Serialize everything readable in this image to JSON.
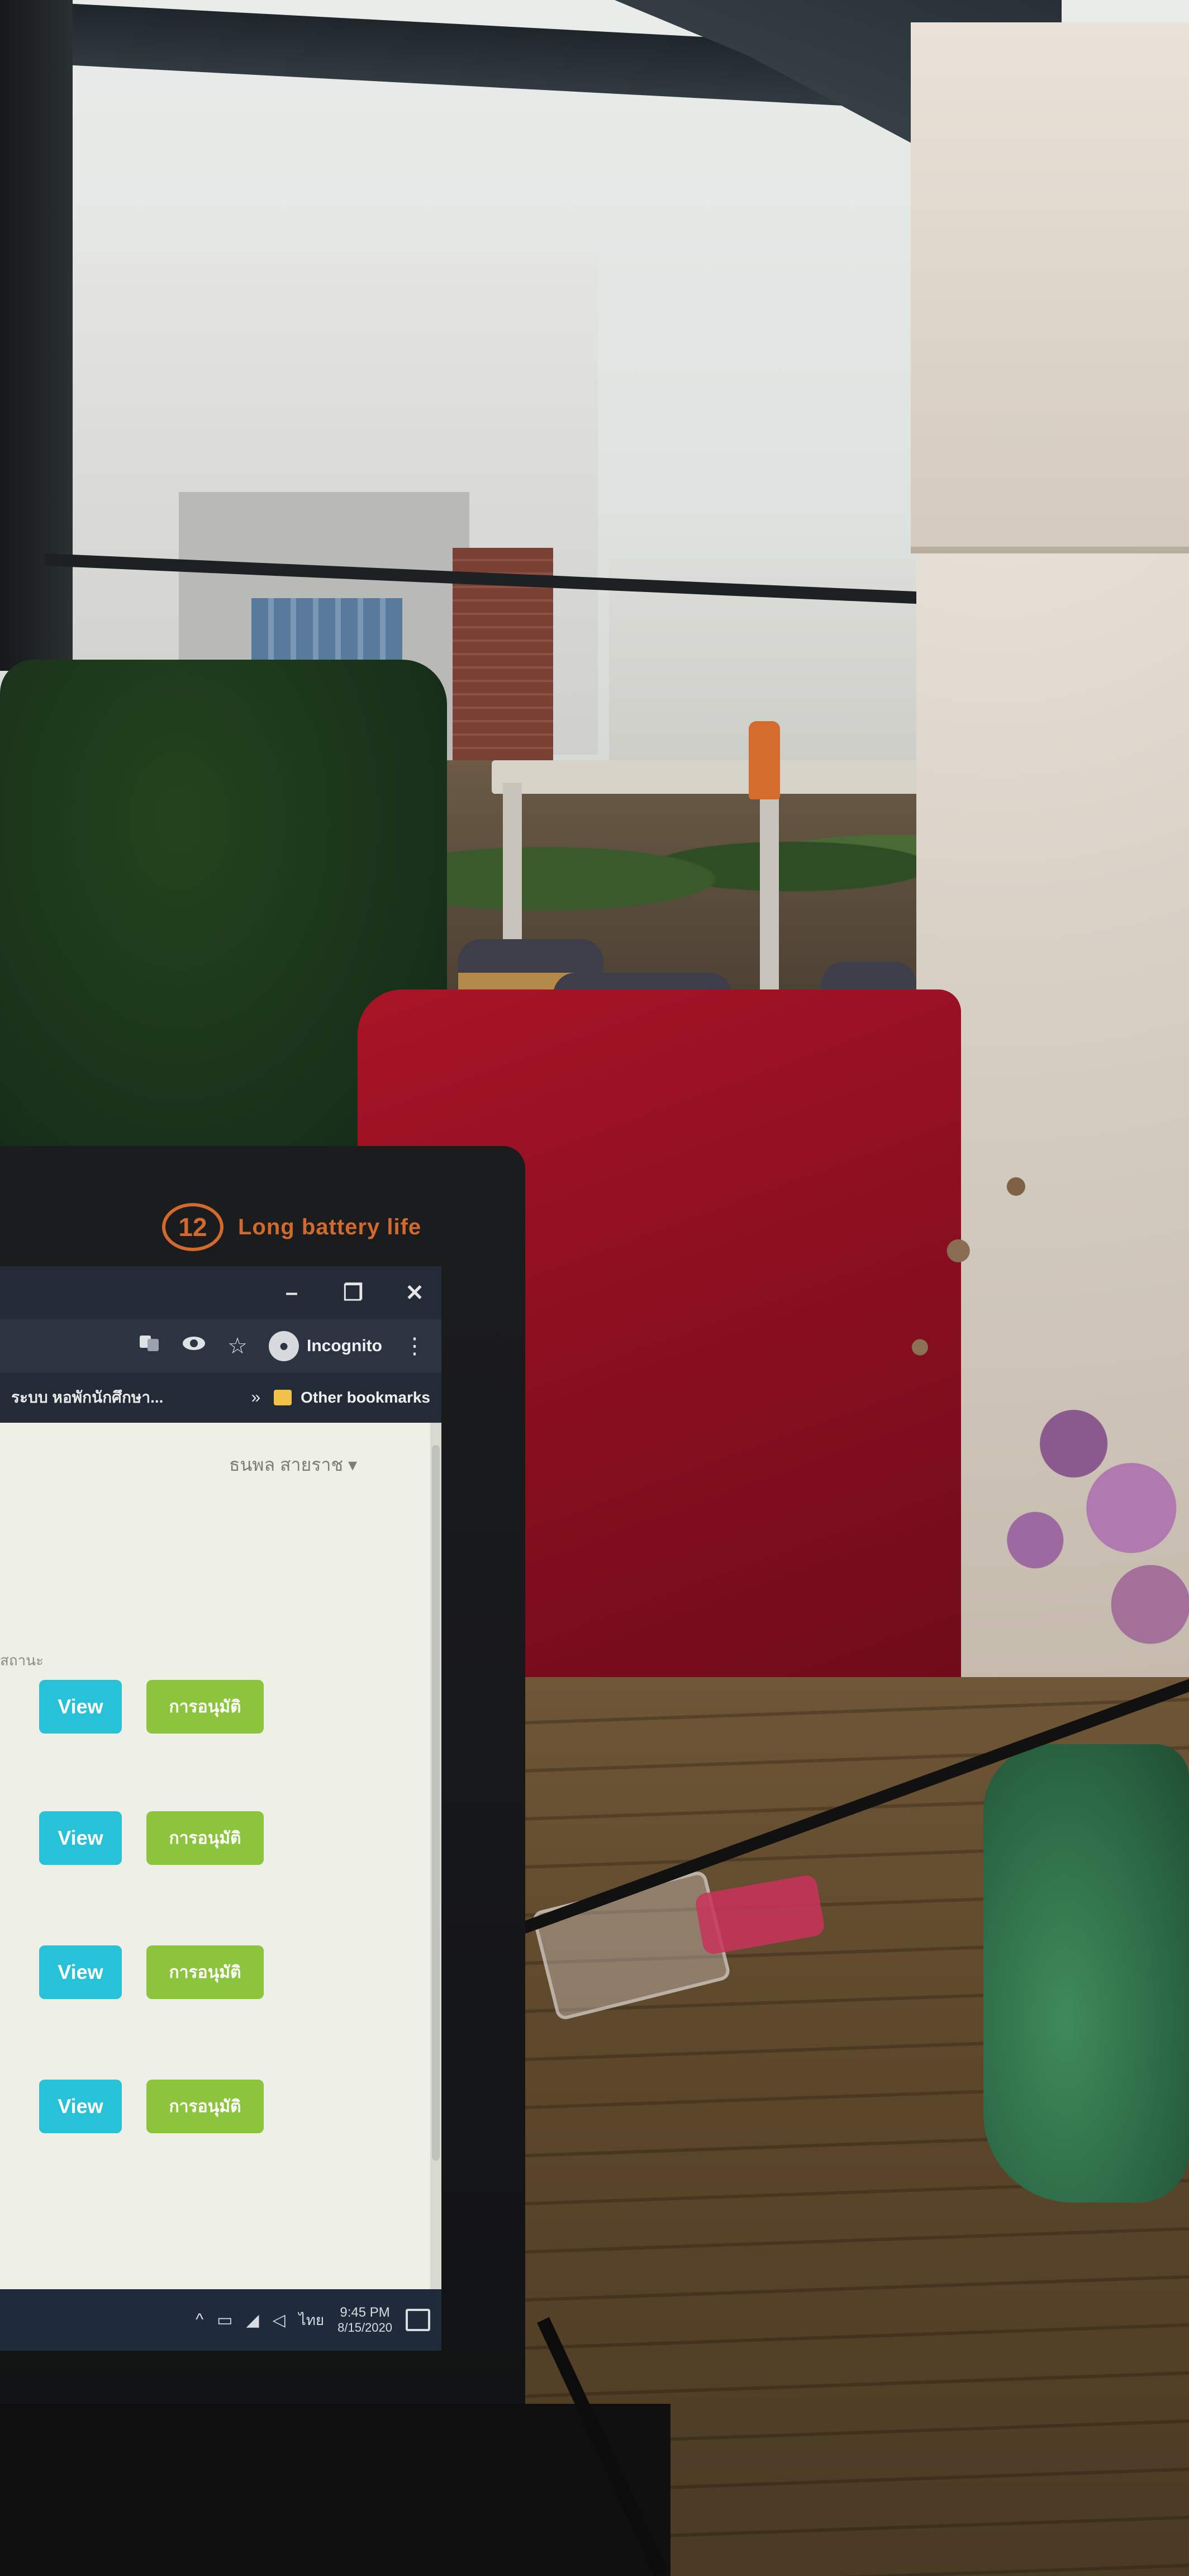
{
  "laptop": {
    "brand_badge": "12",
    "brand_tagline": "Long battery life"
  },
  "browser": {
    "window_controls": {
      "minimize": "–",
      "restore": "❐",
      "close": "✕"
    },
    "toolbar": {
      "translate_icon": "translate-icon",
      "eye_icon": "eye-icon",
      "star_icon": "star-icon",
      "profile_label": "Incognito",
      "menu_icon": "⋮"
    },
    "bookmarks_bar": {
      "tab_title": "ระบบ หอพักนักศึกษา...",
      "overflow": "»",
      "other_bookmarks": "Other bookmarks"
    }
  },
  "page": {
    "user_menu": "ธนพล สายราช ▾",
    "section_label": "สถานะ",
    "rows": [
      {
        "view_label": "View",
        "action_label": "การอนุมัติ"
      },
      {
        "view_label": "View",
        "action_label": "การอนุมัติ"
      },
      {
        "view_label": "View",
        "action_label": "การอนุมัติ"
      },
      {
        "view_label": "View",
        "action_label": "การอนุมัติ"
      }
    ]
  },
  "taskbar": {
    "chevron": "^",
    "lang": "ไทย",
    "time": "9:45 PM",
    "date": "8/15/2020"
  },
  "colors": {
    "view_button": "#27c2d8",
    "action_button": "#8cc53d",
    "brand_orange": "#d2692d"
  }
}
